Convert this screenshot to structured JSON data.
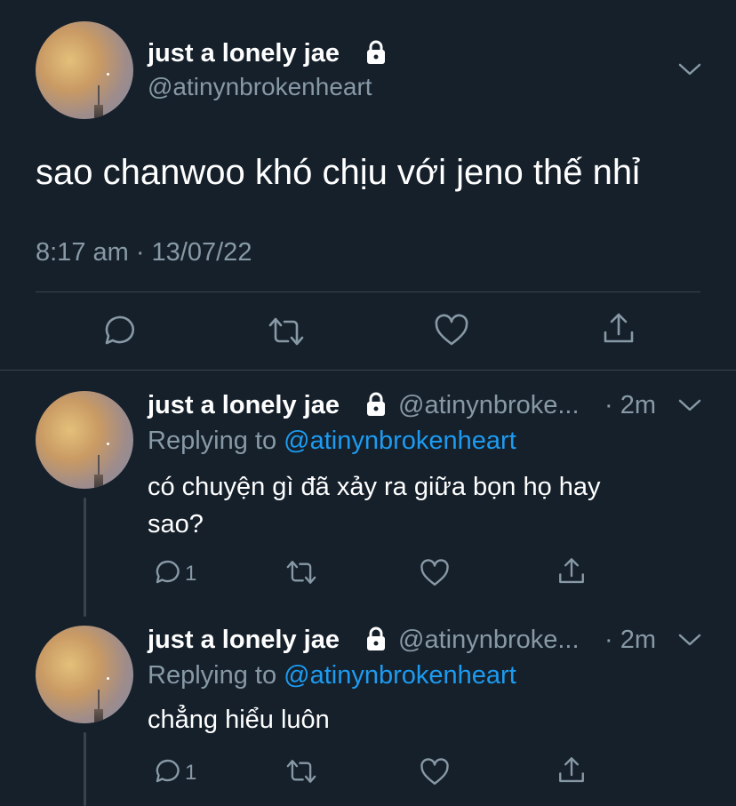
{
  "main_tweet": {
    "display_name": "just a lonely jae",
    "handle": "@atinynbrokenheart",
    "text": "sao chanwoo khó chịu với jeno thế nhỉ",
    "timestamp": "8:17 am · 13/07/22"
  },
  "replies": [
    {
      "display_name": "just a lonely jae",
      "handle": "@atinynbroke...",
      "time": "· 2m",
      "replying_prefix": "Replying to",
      "replying_handle": "@atinynbrokenheart",
      "text_line1": "có chuyện gì đã xảy ra giữa bọn họ hay",
      "text_line2": "sao?",
      "reply_count": "1"
    },
    {
      "display_name": "just a lonely jae",
      "handle": "@atinynbroke...",
      "time": "· 2m",
      "replying_prefix": "Replying to",
      "replying_handle": "@atinynbrokenheart",
      "text_line1": "chẳng hiểu luôn",
      "reply_count": "1"
    }
  ],
  "colors": {
    "background": "#15202b",
    "text": "#ffffff",
    "muted": "#8899a6",
    "link": "#1d9bf0",
    "divider": "#38444d"
  },
  "icons": [
    "lock-icon",
    "chevron-down-icon",
    "reply-icon",
    "retweet-icon",
    "like-icon",
    "share-icon"
  ]
}
